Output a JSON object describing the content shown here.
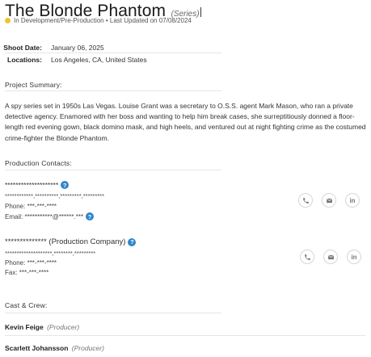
{
  "header": {
    "title": "The Blonde Phantom",
    "series_tag": "(Series)",
    "status": "In Development/Pre-Production",
    "updated": "• Last Updated on 07/08/2024",
    "status_color": "#f2c230"
  },
  "meta": {
    "shoot_date_label": "Shoot Date:",
    "shoot_date_value": "January 06, 2025",
    "locations_label": "Locations:",
    "locations_value": "Los Angeles, CA, United States"
  },
  "summary": {
    "heading": "Project Summary:",
    "text": "A spy series set in 1950s Las Vegas. Louise Grant was a secretary to O.S.S. agent Mark Mason, who ran a private detective agency. Enamored with her boss and wanting to help him break cases, she surreptitiously donned a floor-length red evening gown, black domino mask, and high heels, and ventured out at night fighting crime as the costumed crime-fighter the Blonde Phantom."
  },
  "contacts": {
    "heading": "Production Contacts:",
    "items": [
      {
        "name": "********************",
        "address": "************,**********,*********,*********",
        "phone": "Phone: ***-***-****",
        "email": "Email: ***********@******.***"
      },
      {
        "name": "**************",
        "company_suffix": "(Production Company)",
        "address": "********************,********,*********",
        "phone": "Phone: ***-***-****",
        "fax": "Fax: ***-***-****"
      }
    ],
    "icons": [
      "phone-icon",
      "email-icon",
      "linkedin-icon"
    ],
    "linkedin_glyph": "in"
  },
  "crew": {
    "heading": "Cast & Crew:",
    "items": [
      {
        "name": "Kevin Feige",
        "role": "(Producer)"
      },
      {
        "name": "Scarlett Johansson",
        "role": "(Producer)"
      }
    ]
  },
  "colors": {
    "help_icon": "#2f86c9",
    "icon_grey": "#777777"
  }
}
